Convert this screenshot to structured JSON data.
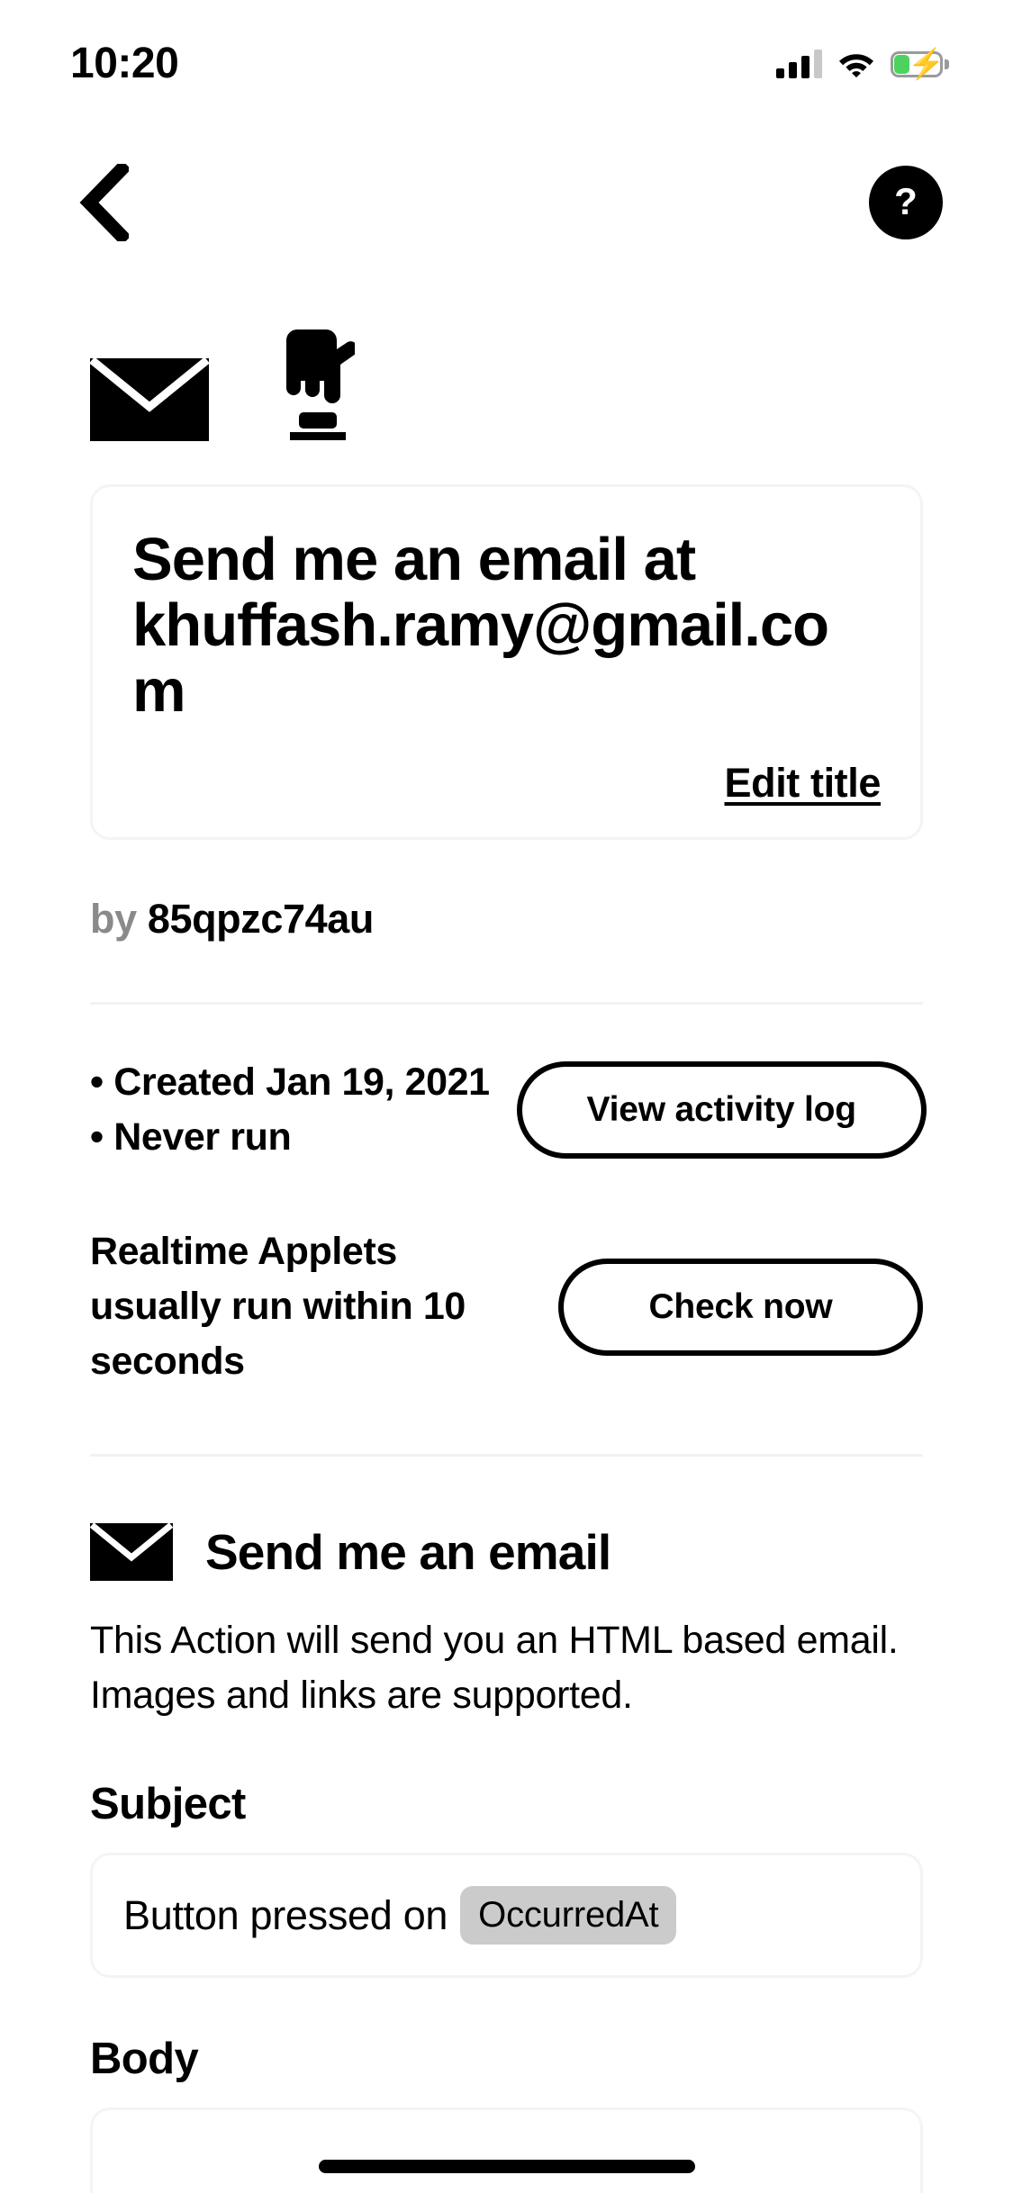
{
  "status_bar": {
    "time": "10:20",
    "signal_icon": "cellular-bars-icon",
    "wifi_icon": "wifi-icon",
    "battery_icon": "battery-charging-icon",
    "battery_fill_color": "#4cd35f"
  },
  "nav": {
    "back_icon": "back-chevron-icon",
    "help_label": "?"
  },
  "service_icons": {
    "trigger": "button-widget-icon",
    "action": "email-envelope-icon"
  },
  "applet": {
    "title": "Send me an email at khuffash.ramy@gmail.com",
    "edit_title_label": "Edit title",
    "by_prefix": "by",
    "author": "85qpzc74au",
    "created_line": "• Created Jan 19, 2021",
    "run_line": "• Never run",
    "activity_log_button": "View activity log",
    "realtime_note": "Realtime Applets usually run within 10 seconds",
    "check_now_button": "Check now"
  },
  "action": {
    "icon": "email-envelope-icon",
    "title": "Send me an email",
    "description": "This Action will send you an HTML based email. Images and links are supported.",
    "fields": [
      {
        "label": "Subject",
        "value_text": "Button pressed on",
        "chip": "OccurredAt"
      },
      {
        "label": "Body",
        "value_text": "",
        "chip": ""
      }
    ]
  },
  "colors": {
    "background": "#ffffff",
    "text": "#000000",
    "muted": "#8a8a8a",
    "border": "#f4f4f4",
    "divider": "#f2f2f2",
    "chip": "#cbcbcb"
  }
}
